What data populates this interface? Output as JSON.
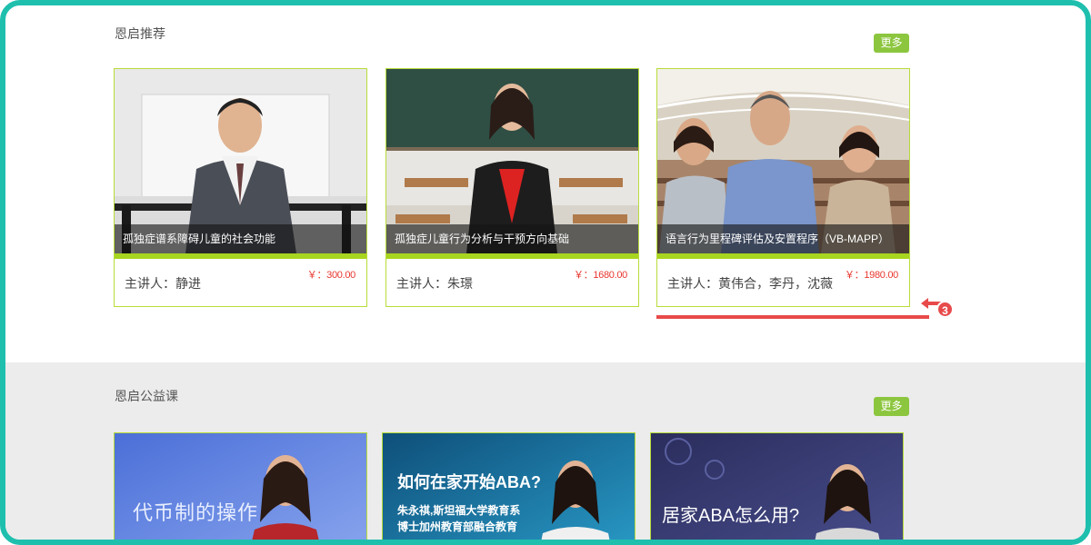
{
  "recommend": {
    "title": "恩启推荐",
    "more": "更多",
    "courses": [
      {
        "caption": "孤独症谱系障碍儿童的社会功能",
        "lecturer": "主讲人：静进",
        "price": "￥：300.00"
      },
      {
        "caption": "孤独症儿童行为分析与干预方向基础",
        "lecturer": "主讲人：朱璟",
        "price": "￥：1680.00"
      },
      {
        "caption": "语言行为里程碑评估及安置程序（VB-MAPP）",
        "lecturer": "主讲人：黄伟合，李丹，沈薇",
        "price": "￥：1980.00"
      }
    ]
  },
  "annotation": {
    "badge": "3",
    "color": "#e84a4a"
  },
  "free": {
    "title": "恩启公益课",
    "more": "更多",
    "courses": [
      {
        "overlay": "代币制的操作"
      },
      {
        "overlay_title": "如何在家开始ABA?",
        "overlay_sub1": "朱永祺,斯坦福大学教育系",
        "overlay_sub2": "博士加州教育部融合教育"
      },
      {
        "overlay": "居家ABA怎么用?"
      }
    ]
  },
  "colors": {
    "frame": "#1fbfae",
    "accent": "#8cc63f",
    "price": "#e8382f",
    "card_border": "#b8dc3a"
  }
}
